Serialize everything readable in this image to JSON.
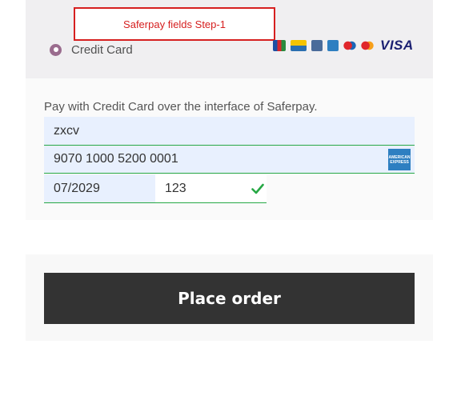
{
  "callout": {
    "text": "Saferpay fields Step-1"
  },
  "payment_method": {
    "label": "Credit Card",
    "selected": true
  },
  "card_brands": [
    "jcb-icon",
    "bancontact-icon",
    "postfinance-icon",
    "amex-icon",
    "maestro-icon",
    "mastercard-icon",
    "visa-logo"
  ],
  "visa_text": "VISA",
  "description": "Pay with Credit Card over the interface of Saferpay.",
  "fields": {
    "holder_name": "zxcv",
    "card_number": "9070 1000 5200 0001",
    "expiry": "07/2029",
    "cvc": "123"
  },
  "amex_badge": "AMERICAN EXPRESS",
  "place_order_label": "Place order",
  "colors": {
    "accent": "#9a6c8e",
    "valid": "#27a845",
    "callout_border": "#d62020",
    "button": "#333333"
  }
}
